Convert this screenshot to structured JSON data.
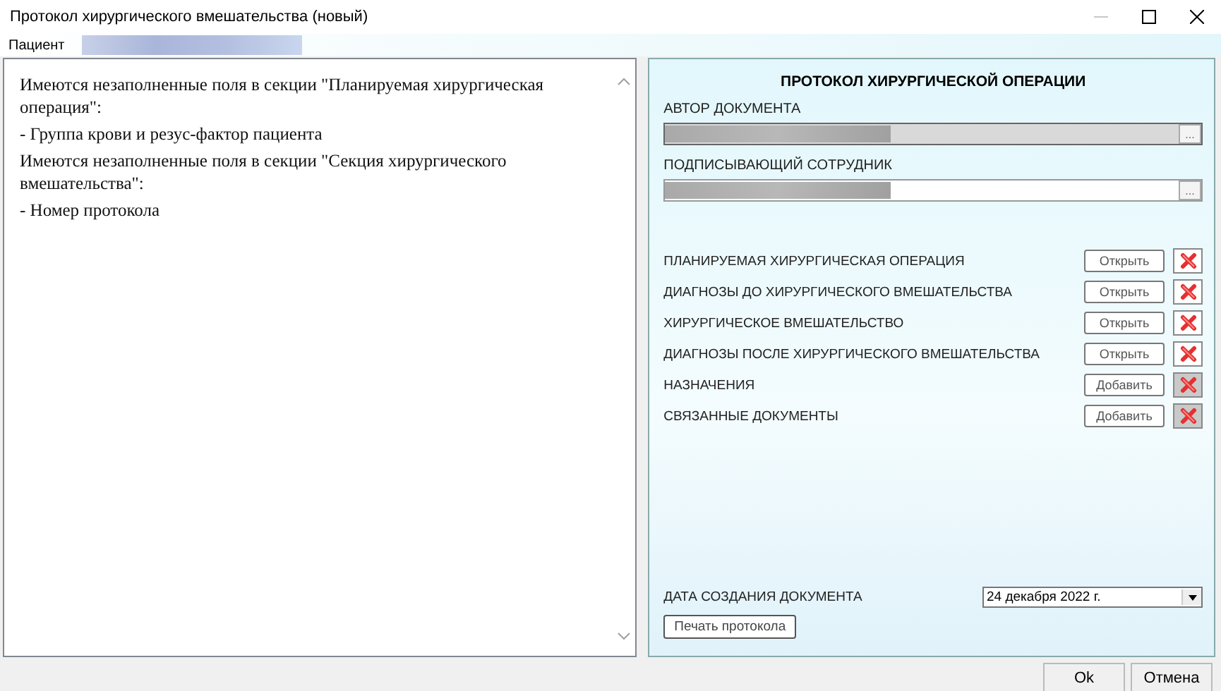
{
  "window": {
    "title": "Протокол хирургического вмешательства (новый)",
    "minimize_disabled": true
  },
  "patient": {
    "label": "Пациент"
  },
  "messages": [
    {
      "text": "Имеются незаполненные поля в секции \"Планируемая хирургическая операция\":"
    },
    {
      "text": "- Группа крови и резус-фактор пациента"
    },
    {
      "text": "Имеются незаполненные поля в секции \"Секция хирургического вмешательства\":"
    },
    {
      "text": "- Номер протокола"
    }
  ],
  "form": {
    "title": "ПРОТОКОЛ ХИРУРГИЧЕСКОЙ ОПЕРАЦИИ",
    "fields": [
      {
        "label": "АВТОР ДОКУМЕНТА",
        "readonly": true,
        "browse": "..."
      },
      {
        "label": "ПОДПИСЫВАЮЩИЙ СОТРУДНИК",
        "readonly": false,
        "browse": "..."
      }
    ],
    "sections": [
      {
        "label": "ПЛАНИРУЕМАЯ ХИРУРГИЧЕСКАЯ ОПЕРАЦИЯ",
        "button": "Открыть",
        "delete_disabled": false
      },
      {
        "label": "ДИАГНОЗЫ ДО ХИРУРГИЧЕСКОГО ВМЕШАТЕЛЬСТВА",
        "button": "Открыть",
        "delete_disabled": false
      },
      {
        "label": "ХИРУРГИЧЕСКОЕ ВМЕШАТЕЛЬСТВО",
        "button": "Открыть",
        "delete_disabled": false
      },
      {
        "label": "ДИАГНОЗЫ ПОСЛЕ ХИРУРГИЧЕСКОГО ВМЕШАТЕЛЬСТВА",
        "button": "Открыть",
        "delete_disabled": false
      },
      {
        "label": "НАЗНАЧЕНИЯ",
        "button": "Добавить",
        "delete_disabled": true
      },
      {
        "label": "СВЯЗАННЫЕ ДОКУМЕНТЫ",
        "button": "Добавить",
        "delete_disabled": true
      }
    ],
    "date_label": "ДАТА СОЗДАНИЯ ДОКУМЕНТА",
    "date_value": "24 декабря  2022 г.",
    "print_button": "Печать протокола"
  },
  "buttons": [
    "Ok",
    "Отмена"
  ]
}
